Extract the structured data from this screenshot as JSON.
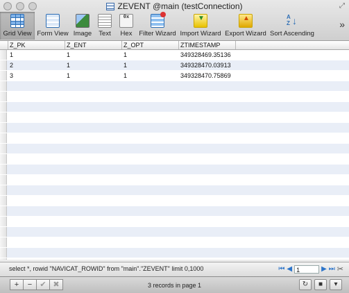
{
  "window": {
    "title": "ZEVENT @main (testConnection)"
  },
  "toolbar": {
    "buttons": [
      {
        "label": "Grid View",
        "icon": "grid-view-icon"
      },
      {
        "label": "Form View",
        "icon": "form-view-icon"
      },
      {
        "label": "Image",
        "icon": "image-icon"
      },
      {
        "label": "Text",
        "icon": "text-icon"
      },
      {
        "label": "Hex",
        "icon": "hex-icon"
      },
      {
        "label": "Filter Wizard",
        "icon": "filter-wizard-icon"
      },
      {
        "label": "Import Wizard",
        "icon": "import-wizard-icon"
      },
      {
        "label": "Export Wizard",
        "icon": "export-wizard-icon"
      },
      {
        "label": "Sort Ascending",
        "icon": "sort-ascending-icon"
      }
    ],
    "hex_glyph": "0x",
    "sort_glyph_a": "A",
    "sort_glyph_z": "Z",
    "overflow": "»"
  },
  "grid": {
    "columns": [
      "Z_PK",
      "Z_ENT",
      "Z_OPT",
      "ZTIMESTAMP"
    ],
    "rows": [
      [
        "1",
        "1",
        "1",
        "349328469.35136"
      ],
      [
        "2",
        "1",
        "1",
        "349328470.03913"
      ],
      [
        "3",
        "1",
        "1",
        "349328470.75869"
      ]
    ]
  },
  "status": {
    "sql": "select *, rowid \"NAVICAT_ROWID\" from \"main\".\"ZEVENT\"  limit 0,1000",
    "page": "1",
    "records_text": "3 records in page 1"
  },
  "bottom": {
    "add": "+",
    "remove": "−",
    "apply": "✔",
    "discard": "✖",
    "refresh": "↻",
    "stop": "■",
    "menu": "▾"
  }
}
